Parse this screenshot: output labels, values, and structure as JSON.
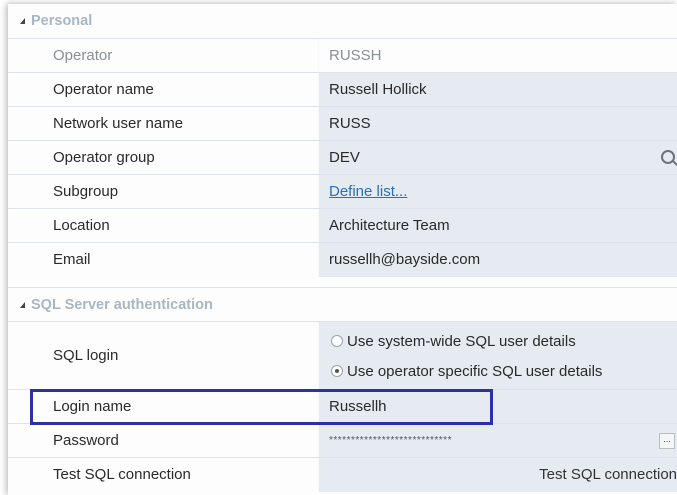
{
  "sections": {
    "personal": "Personal",
    "sql": "SQL Server authentication"
  },
  "personal": {
    "operator": {
      "label": "Operator",
      "value": "RUSSH"
    },
    "operator_name": {
      "label": "Operator name",
      "value": "Russell Hollick"
    },
    "network_user": {
      "label": "Network user name",
      "value": "RUSS"
    },
    "operator_group": {
      "label": "Operator group",
      "value": "DEV",
      "icon": "search-icon"
    },
    "subgroup": {
      "label": "Subgroup",
      "value": "Define list..."
    },
    "location": {
      "label": "Location",
      "value": "Architecture Team"
    },
    "email": {
      "label": "Email",
      "value": "russellh@bayside.com"
    }
  },
  "sql": {
    "sql_login": {
      "label": "SQL login",
      "option_system": "Use system-wide SQL user details",
      "option_operator": "Use operator specific SQL user details",
      "selected": "option_operator"
    },
    "login_name": {
      "label": "Login name",
      "value": "Russellh"
    },
    "password": {
      "label": "Password",
      "value": "****************************",
      "button": "..."
    },
    "test_connection": {
      "label": "Test SQL connection",
      "button": "Test SQL connection"
    }
  },
  "colors": {
    "highlight_border": "#2c31a8",
    "value_bg": "#e5ebf0",
    "section_header": "#a8b7c2",
    "link": "#2a6ebb"
  }
}
